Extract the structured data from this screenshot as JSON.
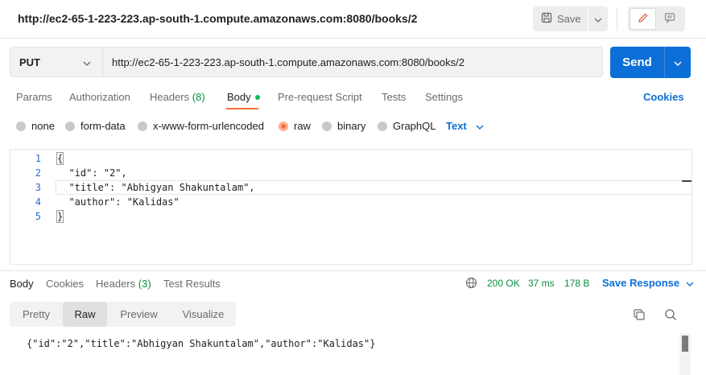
{
  "header": {
    "title": "http://ec2-65-1-223-223.ap-south-1.compute.amazonaws.com:8080/books/2",
    "save_label": "Save"
  },
  "request": {
    "method": "PUT",
    "url": "http://ec2-65-1-223-223.ap-south-1.compute.amazonaws.com:8080/books/2",
    "send_label": "Send"
  },
  "request_tabs": {
    "params": "Params",
    "authorization": "Authorization",
    "headers": "Headers",
    "headers_count": "(8)",
    "body": "Body",
    "pre_request": "Pre-request Script",
    "tests": "Tests",
    "settings": "Settings",
    "cookies": "Cookies"
  },
  "body_types": {
    "none": "none",
    "form_data": "form-data",
    "urlencoded": "x-www-form-urlencoded",
    "raw": "raw",
    "binary": "binary",
    "graphql": "GraphQL",
    "language": "Text"
  },
  "editor": {
    "line_numbers": [
      "1",
      "2",
      "3",
      "4",
      "5"
    ],
    "lines": [
      "{",
      "  \"id\": \"2\",",
      "  \"title\": \"Abhigyan Shakuntalam\",",
      "  \"author\": \"Kalidas\"",
      "}"
    ]
  },
  "response": {
    "tabs": {
      "body": "Body",
      "cookies": "Cookies",
      "headers": "Headers",
      "headers_count": "(3)",
      "test_results": "Test Results"
    },
    "status": "200 OK",
    "time": "37 ms",
    "size": "178 B",
    "save_response": "Save Response",
    "views": {
      "pretty": "Pretty",
      "raw": "Raw",
      "preview": "Preview",
      "visualize": "Visualize"
    },
    "content": "{\"id\":\"2\",\"title\":\"Abhigyan Shakuntalam\",\"author\":\"Kalidas\"}"
  },
  "colors": {
    "accent_blue": "#0c6fd8",
    "accent_orange": "#ff6c37",
    "success_green": "#0a8f3d"
  },
  "icons": {
    "save": "save-icon",
    "chevron": "chevron-down-icon",
    "edit": "pencil-icon",
    "comments": "comment-icon",
    "globe": "globe-icon",
    "copy": "copy-icon",
    "search": "search-icon"
  }
}
